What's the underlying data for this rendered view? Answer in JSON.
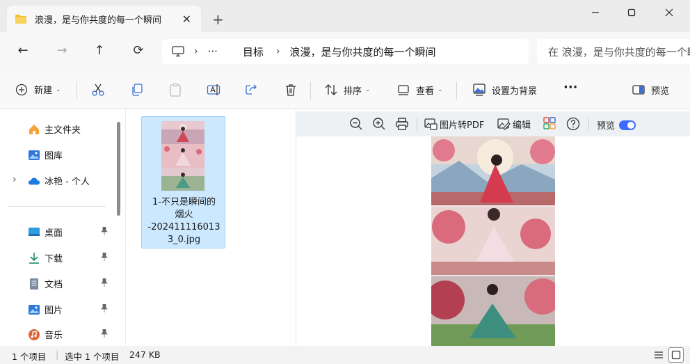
{
  "tab": {
    "title": "浪漫，是与你共度的每一个瞬间",
    "close": "✕",
    "new_tab": "+"
  },
  "window": {
    "minimize": "─",
    "maximize": "☐",
    "close": "✕"
  },
  "nav": {
    "back": "←",
    "forward": "→",
    "up": "↑",
    "refresh": "⟳"
  },
  "address": {
    "more": "···",
    "sep": "›",
    "crumbs": [
      "目标",
      "浪漫，是与你共度的每一个瞬间"
    ]
  },
  "search": {
    "placeholder": "在 浪漫，是与你共度的每一个瞬间 中搜索"
  },
  "commands": {
    "new": "新建",
    "sort": "排序",
    "view": "查看",
    "set_background": "设置为背景",
    "more": "···",
    "preview": "预览"
  },
  "sidebar": {
    "quick": [
      {
        "label": "主文件夹",
        "icon": "home-icon"
      },
      {
        "label": "图库",
        "icon": "gallery-icon"
      },
      {
        "label": "冰艳 - 个人",
        "icon": "cloud-icon"
      }
    ],
    "pinned": [
      {
        "label": "桌面",
        "icon": "desktop-icon"
      },
      {
        "label": "下载",
        "icon": "download-icon"
      },
      {
        "label": "文档",
        "icon": "document-icon"
      },
      {
        "label": "图片",
        "icon": "pictures-icon"
      },
      {
        "label": "音乐",
        "icon": "music-icon"
      }
    ],
    "expand": "›",
    "pin": "📌"
  },
  "files": [
    {
      "name": "1-不只是瞬间的烟火-2024111160133_0.jpg",
      "name_lines": [
        "1-不只是瞬间的",
        "烟火",
        "-202411116013",
        "3_0.jpg"
      ],
      "selected": true
    }
  ],
  "preview_toolbar": {
    "to_pdf": "图片转PDF",
    "edit": "编辑",
    "preview": "预览",
    "preview_on": true
  },
  "status": {
    "count": "1 个项目",
    "selected": "选中 1 个项目",
    "size": "247 KB"
  },
  "colors": {
    "accent": "#3b6bff",
    "selection": "#cce8ff",
    "selection_border": "#99d1ff",
    "folder": "#f3c13a"
  }
}
